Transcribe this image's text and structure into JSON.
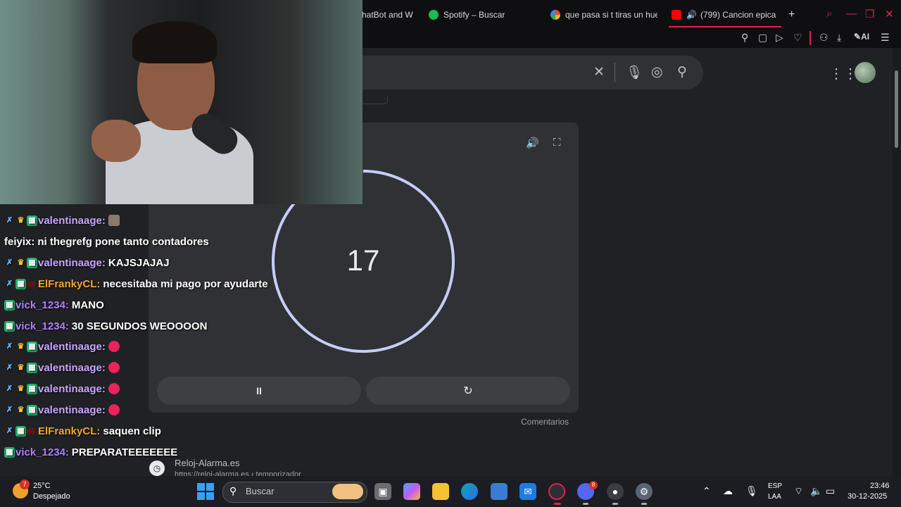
{
  "tabs": [
    {
      "label": "hatBot and W",
      "color": "#444"
    },
    {
      "label": "Spotify – Buscar",
      "color": "#1db954"
    },
    {
      "label": "que pasa si t tiras un hue",
      "color": "#4285f4"
    },
    {
      "label": "(799) Cancion epica",
      "color": "#ff0000"
    }
  ],
  "new_tab": "+",
  "toolbar_icons": [
    "pin-icon",
    "screenshot-icon",
    "play-icon",
    "heart-icon",
    "account-icon",
    "download-icon",
    "ai-icon",
    "menu-icon"
  ],
  "toolbar_ai_label": "AI",
  "search": {
    "clear": "×",
    "mic": "🎤",
    "lens": "◉",
    "search": "🔍"
  },
  "timer": {
    "value": "17",
    "progress": 0.98,
    "pause_label": "II",
    "reset_label": "↻",
    "sound_icon": "speaker-icon",
    "fullscreen_icon": "fullscreen-icon"
  },
  "comentarios": "Comentarios",
  "result": {
    "site": "Reloj-Alarma.es",
    "url": "https://reloj-alarma.es › temporizador"
  },
  "chat": [
    {
      "user": "valentinaage",
      "color": "#c9a6ff",
      "badges": [
        "sword",
        "crown",
        "bit"
      ],
      "msg": "",
      "emote": "face"
    },
    {
      "user": "feiyix",
      "color": "#ffffff",
      "badges": [],
      "msg": "ni thegrefg pone tanto contadores",
      "emote": ""
    },
    {
      "user": "valentinaage",
      "color": "#c9a6ff",
      "badges": [
        "sword",
        "crown",
        "bit"
      ],
      "msg": "KAJSJAJAJ",
      "emote": ""
    },
    {
      "user": "ElFrankyCL",
      "color": "#f0a830",
      "badges": [
        "sword",
        "bit",
        "red"
      ],
      "msg": "necesitaba mi pago por ayudarte",
      "emote": ""
    },
    {
      "user": "vick_1234",
      "color": "#b080ff",
      "badges": [
        "bit"
      ],
      "msg": "MANO",
      "emote": ""
    },
    {
      "user": "vick_1234",
      "color": "#b080ff",
      "badges": [
        "bit"
      ],
      "msg": "30 SEGUNDOS WEOOOON",
      "emote": ""
    },
    {
      "user": "valentinaage",
      "color": "#c9a6ff",
      "badges": [
        "sword",
        "crown",
        "bit"
      ],
      "msg": "",
      "emote": "heart"
    },
    {
      "user": "valentinaage",
      "color": "#c9a6ff",
      "badges": [
        "sword",
        "crown",
        "bit"
      ],
      "msg": "",
      "emote": "heart"
    },
    {
      "user": "valentinaage",
      "color": "#c9a6ff",
      "badges": [
        "sword",
        "crown",
        "bit"
      ],
      "msg": "",
      "emote": "heart"
    },
    {
      "user": "valentinaage",
      "color": "#c9a6ff",
      "badges": [
        "sword",
        "crown",
        "bit"
      ],
      "msg": "",
      "emote": "heart"
    },
    {
      "user": "ElFrankyCL",
      "color": "#f0a830",
      "badges": [
        "sword",
        "bit",
        "red"
      ],
      "msg": "saquen clip",
      "emote": ""
    },
    {
      "user": "vick_1234",
      "color": "#b080ff",
      "badges": [
        "bit"
      ],
      "msg": "PREPARATEEEEEEE",
      "emote": ""
    }
  ],
  "taskbar": {
    "weather_badge": "7",
    "temp": "25°C",
    "condition": "Despejado",
    "search_placeholder": "Buscar",
    "lang1": "ESP",
    "lang2": "LAA",
    "time": "23:46",
    "date": "30-12-2025",
    "discord_badge": "8"
  }
}
